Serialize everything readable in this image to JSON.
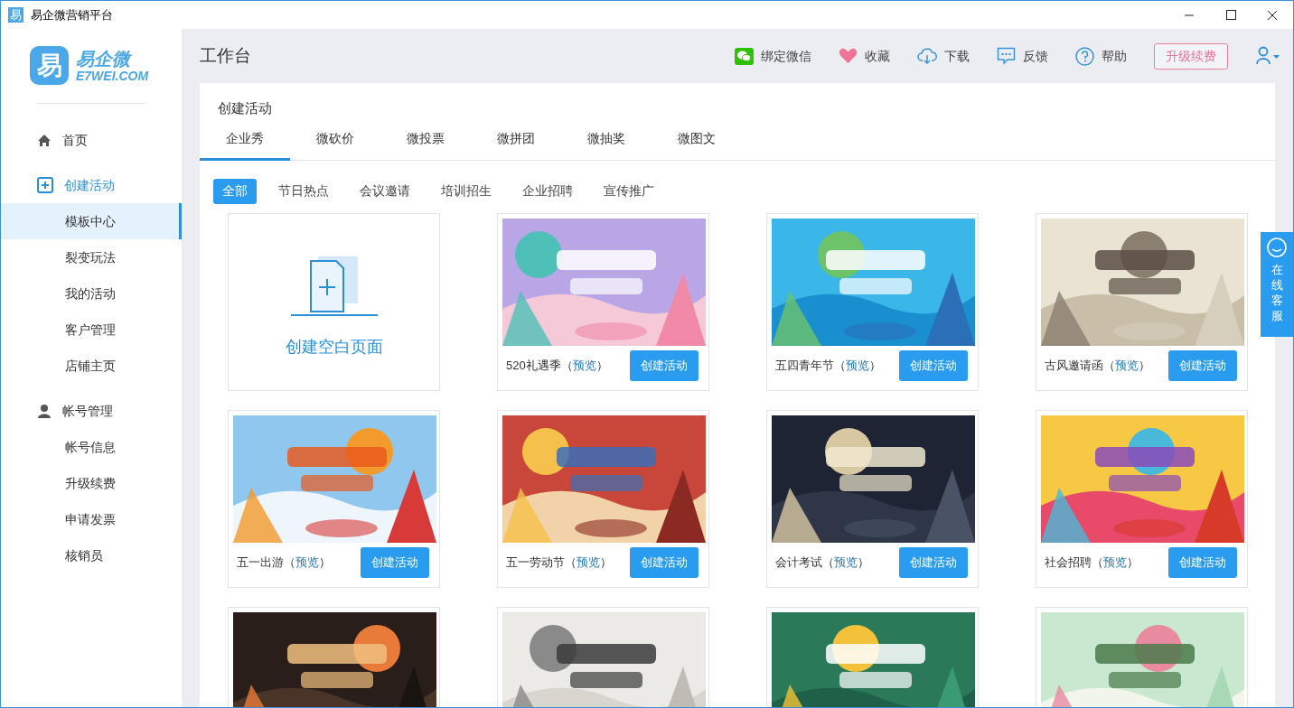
{
  "window": {
    "icon_text": "易",
    "title": "易企微营销平台"
  },
  "logo": {
    "mark": "易",
    "name": "易企微",
    "domain": "E7WEI.COM"
  },
  "sidebar": {
    "sections": [
      {
        "kind": "home",
        "label": "首页",
        "active": false
      },
      {
        "kind": "create",
        "label": "创建活动",
        "active": true,
        "children": [
          {
            "label": "模板中心",
            "selected": true
          },
          {
            "label": "裂变玩法",
            "selected": false
          },
          {
            "label": "我的活动",
            "selected": false
          },
          {
            "label": "客户管理",
            "selected": false
          },
          {
            "label": "店铺主页",
            "selected": false
          }
        ]
      },
      {
        "kind": "account",
        "label": "帐号管理",
        "active": false,
        "children": [
          {
            "label": "帐号信息",
            "selected": false
          },
          {
            "label": "升级续费",
            "selected": false
          },
          {
            "label": "申请发票",
            "selected": false
          },
          {
            "label": "核销员",
            "selected": false
          }
        ]
      }
    ]
  },
  "header": {
    "title": "工作台",
    "actions": [
      {
        "kind": "wechat",
        "label": "绑定微信"
      },
      {
        "kind": "heart",
        "label": "收藏"
      },
      {
        "kind": "download",
        "label": "下载"
      },
      {
        "kind": "feedback",
        "label": "反馈"
      },
      {
        "kind": "help",
        "label": "帮助"
      }
    ],
    "upgrade_button": "升级续费"
  },
  "panel": {
    "title": "创建活动",
    "tabs": [
      {
        "label": "企业秀",
        "selected": true
      },
      {
        "label": "微砍价",
        "selected": false
      },
      {
        "label": "微投票",
        "selected": false
      },
      {
        "label": "微拼团",
        "selected": false
      },
      {
        "label": "微抽奖",
        "selected": false
      },
      {
        "label": "微图文",
        "selected": false
      }
    ],
    "filters": [
      {
        "label": "全部",
        "selected": true
      },
      {
        "label": "节日热点",
        "selected": false
      },
      {
        "label": "会议邀请",
        "selected": false
      },
      {
        "label": "培训招生",
        "selected": false
      },
      {
        "label": "企业招聘",
        "selected": false
      },
      {
        "label": "宣传推广",
        "selected": false
      }
    ],
    "templates": [
      {
        "kind": "blank",
        "label": "创建空白页面"
      },
      {
        "kind": "template",
        "name": "520礼遇季",
        "paren_open": "（",
        "preview": "预览",
        "paren_close": "）",
        "button": "创建活动"
      },
      {
        "kind": "template",
        "name": "五四青年节",
        "paren_open": "（",
        "preview": "预览",
        "paren_close": "）",
        "button": "创建活动"
      },
      {
        "kind": "template",
        "name": "古风邀请函",
        "paren_open": "（",
        "preview": "预览",
        "paren_close": "）",
        "button": "创建活动"
      },
      {
        "kind": "template",
        "name": "五一出游",
        "paren_open": "（",
        "preview": "预览",
        "paren_close": "）",
        "button": "创建活动"
      },
      {
        "kind": "template",
        "name": "五一劳动节",
        "paren_open": "（",
        "preview": "预览",
        "paren_close": "）",
        "button": "创建活动"
      },
      {
        "kind": "template",
        "name": "会计考试",
        "paren_open": "（",
        "preview": "预览",
        "paren_close": "）",
        "button": "创建活动"
      },
      {
        "kind": "template",
        "name": "社会招聘",
        "paren_open": "（",
        "preview": "预览",
        "paren_close": "）",
        "button": "创建活动"
      },
      {
        "kind": "picture"
      },
      {
        "kind": "picture"
      },
      {
        "kind": "picture"
      },
      {
        "kind": "picture"
      }
    ]
  },
  "service_tab": {
    "label": "在线客服"
  }
}
